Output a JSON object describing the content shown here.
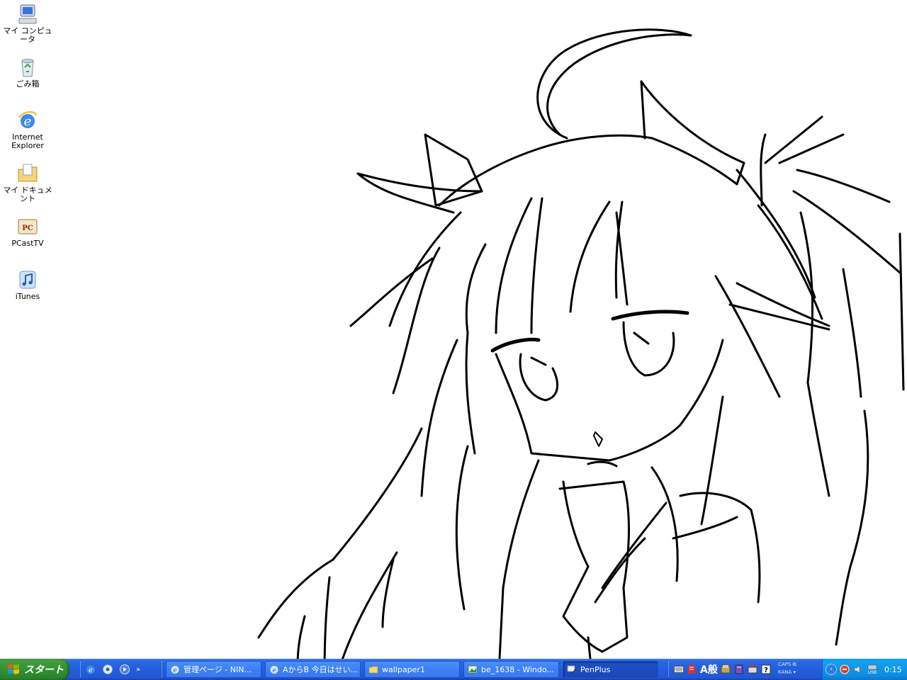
{
  "desktop": {
    "background_color": "#ffffff",
    "icons": [
      {
        "label": "マイ コンピュータ",
        "icon": "my-computer-icon"
      },
      {
        "label": "ごみ箱",
        "icon": "recycle-bin-icon"
      },
      {
        "label": "Internet\nExplorer",
        "icon": "internet-explorer-icon"
      },
      {
        "label": "マイ ドキュメント",
        "icon": "my-documents-icon"
      },
      {
        "label": "PCastTV",
        "icon": "pcasttv-icon"
      },
      {
        "label": "iTunes",
        "icon": "itunes-icon"
      }
    ]
  },
  "taskbar": {
    "start_label": "スタート",
    "quick_launch_icons": [
      "internet-explorer-icon",
      "media-player-icon",
      "windows-media-icon"
    ],
    "quick_launch_more": "»",
    "tasks": [
      {
        "label": "管理ページ - NIN...",
        "icon": "internet-explorer-icon",
        "active": false
      },
      {
        "label": "AからB 今日はせい...",
        "icon": "internet-explorer-icon",
        "active": false
      },
      {
        "label": "wallpaper1",
        "icon": "folder-icon",
        "active": false
      },
      {
        "label": "be_1638 - Windo...",
        "icon": "image-viewer-icon",
        "active": false
      },
      {
        "label": "PenPlus",
        "icon": "penplus-icon",
        "active": true
      }
    ],
    "language_bar": {
      "ime_text": "A般"
    },
    "lock_keys": {
      "caps": "CAPS",
      "kana": "KANA"
    },
    "tray": {
      "usb_label": "USB",
      "clock": "0:15"
    }
  },
  "colors": {
    "taskbar_blue": "#245edb",
    "start_green": "#3c9a3c",
    "tray_blue": "#0f8ce0"
  }
}
